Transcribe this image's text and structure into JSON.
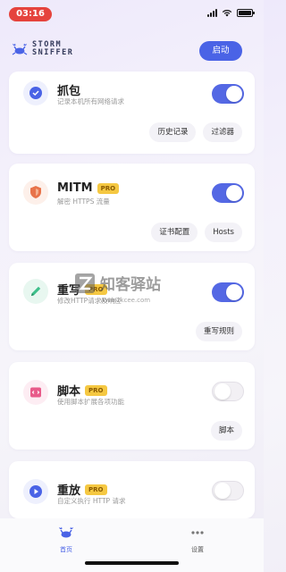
{
  "status_bar": {
    "time": "03:16"
  },
  "header": {
    "logo_line1": "STORM",
    "logo_line2": "SNIFFER",
    "start_button": "启动"
  },
  "cards": [
    {
      "title": "抓包",
      "subtitle": "记录本机所有网络请求",
      "pro": false,
      "toggle_on": true,
      "chips": [
        "历史记录",
        "过滤器"
      ],
      "icon": "clock-icon",
      "icon_color": "#4a63e6"
    },
    {
      "title": "MITM",
      "subtitle": "解密 HTTPS 流量",
      "pro": true,
      "toggle_on": true,
      "chips": [
        "证书配置",
        "Hosts"
      ],
      "icon": "shield-icon",
      "icon_color": "#e8734a"
    },
    {
      "title": "重写",
      "subtitle": "修改HTTP请求及响应",
      "pro": true,
      "toggle_on": true,
      "chips": [
        "重写规则"
      ],
      "icon": "pencil-icon",
      "icon_color": "#3dbf8a"
    },
    {
      "title": "脚本",
      "subtitle": "使用脚本扩展各项功能",
      "pro": true,
      "toggle_on": false,
      "chips": [
        "脚本"
      ],
      "icon": "script-icon",
      "icon_color": "#e85b8a"
    },
    {
      "title": "重放",
      "subtitle": "自定义执行 HTTP 请求",
      "pro": true,
      "toggle_on": false,
      "chips": [],
      "icon": "play-icon",
      "icon_color": "#4a63e6"
    }
  ],
  "pro_label": "PRO",
  "watermark": {
    "text": "知客驿站",
    "url": "www.zkcee.com"
  },
  "tabs": [
    {
      "label": "首页",
      "active": true,
      "icon": "crab-icon"
    },
    {
      "label": "设置",
      "active": false,
      "icon": "more-dots-icon"
    }
  ],
  "colors": {
    "accent": "#4a63e6",
    "toggle_on": "#5468e4",
    "pro_badge": "#f5c842",
    "time_pill": "#e5433d"
  }
}
